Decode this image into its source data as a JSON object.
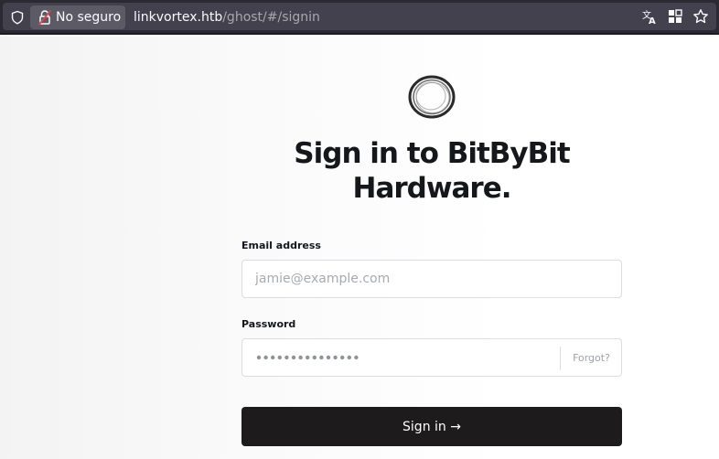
{
  "browser": {
    "security_label": "No seguro",
    "url_host": "linkvortex.htb",
    "url_path": "/ghost/#/signin",
    "icons": [
      "shield-icon",
      "lock-icon",
      "translate-icon",
      "extensions-grid-icon",
      "bookmark-star-icon"
    ]
  },
  "signin": {
    "title": "Sign in to BitByBit Hardware.",
    "email_label": "Email address",
    "email_placeholder": "jamie@example.com",
    "password_label": "Password",
    "password_value": "•••••••••••••••",
    "forgot_label": "Forgot?",
    "submit_label": "Sign in →"
  },
  "colors": {
    "browser_bar": "#2b2a33",
    "url_field": "#42414d",
    "button_bg": "#1d1b1c",
    "title_text": "#15171a",
    "lock_accent": "#e2424a"
  }
}
